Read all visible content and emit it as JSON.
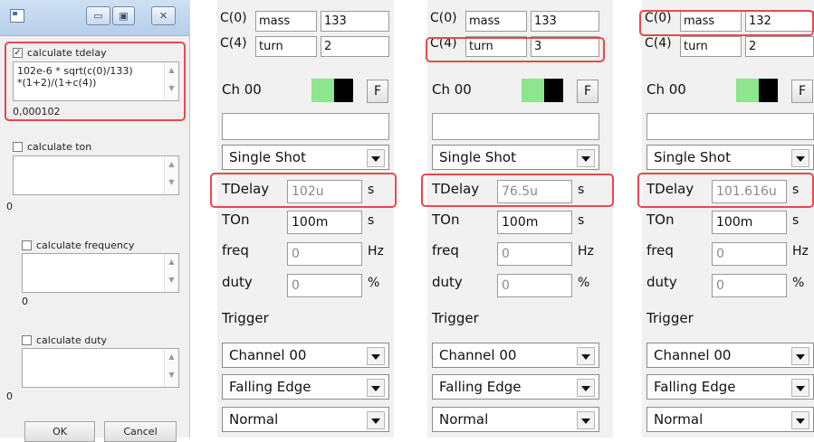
{
  "dialog": {
    "sections": [
      {
        "label": "calculate tdelay",
        "checked": true,
        "checkmark": "✓",
        "expression": "102e-6 * sqrt(c(0)/133)\n*(1+2)/(1+c(4))",
        "result": "0,000102"
      },
      {
        "label": "calculate ton",
        "checked": false,
        "checkmark": "",
        "expression": "",
        "result": "0"
      },
      {
        "label": "calculate frequency",
        "checked": false,
        "checkmark": "",
        "expression": "",
        "result": "0"
      },
      {
        "label": "calculate duty",
        "checked": false,
        "checkmark": "",
        "expression": "",
        "result": "0"
      }
    ],
    "ok_label": "OK",
    "cancel_label": "Cancel",
    "window_controls": {
      "minimize": "minimize-icon",
      "maximize": "maximize-icon",
      "close": "close-icon"
    },
    "scroll_up_glyph": "▲",
    "scroll_down_glyph": "▼",
    "min_glyph": "▭",
    "max_glyph": "▣",
    "close_glyph": "✕"
  },
  "panels": [
    {
      "c0_label": "C(0)",
      "c0_name": "mass",
      "c0_value": "133",
      "c4_label": "C(4)",
      "c4_name": "turn",
      "c4_value": "2",
      "channel": "Ch 00",
      "f_button": "F",
      "mode": "Single Shot",
      "tdelay_label": "TDelay",
      "tdelay_value": "102u",
      "tdelay_unit": "s",
      "ton_label": "TOn",
      "ton_value": "100m",
      "ton_unit": "s",
      "freq_label": "freq",
      "freq_value": "0",
      "freq_unit": "Hz",
      "duty_label": "duty",
      "duty_value": "0",
      "duty_unit": "%",
      "trigger_label": "Trigger",
      "trigger_channel": "Channel 00",
      "trigger_edge": "Falling Edge",
      "trigger_mode": "Normal"
    },
    {
      "c0_label": "C(0)",
      "c0_name": "mass",
      "c0_value": "133",
      "c4_label": "C(4)",
      "c4_name": "turn",
      "c4_value": "3",
      "channel": "Ch 00",
      "f_button": "F",
      "mode": "Single Shot",
      "tdelay_label": "TDelay",
      "tdelay_value": "76.5u",
      "tdelay_unit": "s",
      "ton_label": "TOn",
      "ton_value": "100m",
      "ton_unit": "s",
      "freq_label": "freq",
      "freq_value": "0",
      "freq_unit": "Hz",
      "duty_label": "duty",
      "duty_value": "0",
      "duty_unit": "%",
      "trigger_label": "Trigger",
      "trigger_channel": "Channel 00",
      "trigger_edge": "Falling Edge",
      "trigger_mode": "Normal"
    },
    {
      "c0_label": "C(0)",
      "c0_name": "mass",
      "c0_value": "132",
      "c4_label": "C(4)",
      "c4_name": "turn",
      "c4_value": "2",
      "channel": "Ch 00",
      "f_button": "F",
      "mode": "Single Shot",
      "tdelay_label": "TDelay",
      "tdelay_value": "101.616u",
      "tdelay_unit": "s",
      "ton_label": "TOn",
      "ton_value": "100m",
      "ton_unit": "s",
      "freq_label": "freq",
      "freq_value": "0",
      "freq_unit": "Hz",
      "duty_label": "duty",
      "duty_value": "0",
      "duty_unit": "%",
      "trigger_label": "Trigger",
      "trigger_channel": "Channel 00",
      "trigger_edge": "Falling Edge",
      "trigger_mode": "Normal"
    }
  ],
  "colors": {
    "highlight": "#e8484d",
    "status_green": "#8ee58e",
    "status_black": "#000000"
  }
}
